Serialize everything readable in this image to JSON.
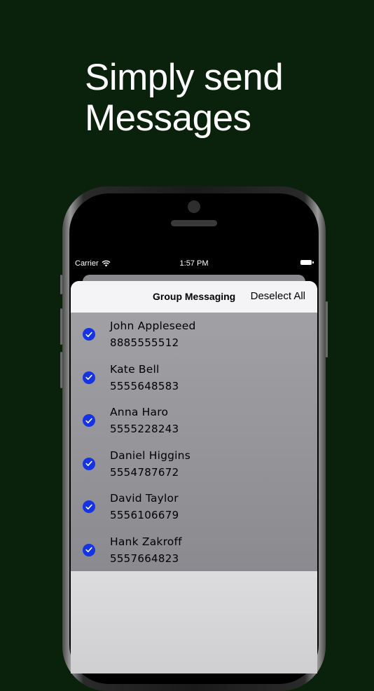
{
  "headline": {
    "line1": "Simply send",
    "line2": "Messages"
  },
  "status_bar": {
    "carrier": "Carrier",
    "time": "1:57 PM"
  },
  "nav": {
    "title": "Group Messaging",
    "deselect_all": "Deselect All"
  },
  "contacts": [
    {
      "name": "John Appleseed",
      "phone": "8885555512",
      "selected": true
    },
    {
      "name": "Kate Bell",
      "phone": "5555648583",
      "selected": true
    },
    {
      "name": "Anna Haro",
      "phone": "5555228243",
      "selected": true
    },
    {
      "name": "Daniel Higgins",
      "phone": "5554787672",
      "selected": true
    },
    {
      "name": "David Taylor",
      "phone": "5556106679",
      "selected": true
    },
    {
      "name": "Hank Zakroff",
      "phone": "5557664823",
      "selected": true
    }
  ],
  "colors": {
    "background": "#0a220b",
    "checkmark_fill": "#1433e6",
    "list_background": "#9a9a9e"
  },
  "icons": {
    "wifi": "wifi-icon",
    "battery": "battery-icon",
    "check": "checkmark-circle-icon"
  }
}
